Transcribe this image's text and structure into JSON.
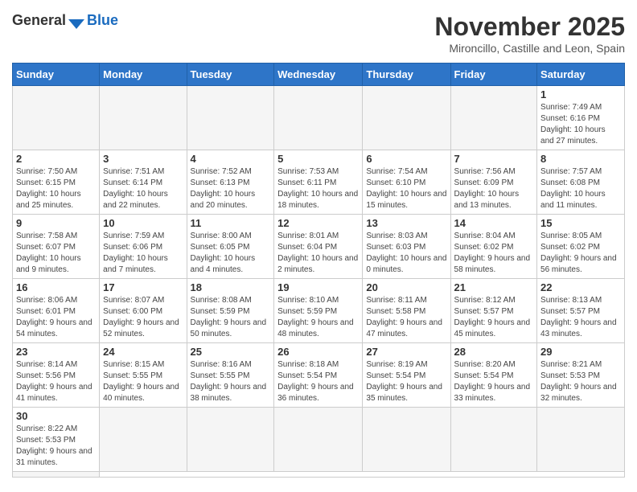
{
  "header": {
    "logo_general": "General",
    "logo_blue": "Blue",
    "month_title": "November 2025",
    "location": "Mironcillo, Castille and Leon, Spain"
  },
  "weekdays": [
    "Sunday",
    "Monday",
    "Tuesday",
    "Wednesday",
    "Thursday",
    "Friday",
    "Saturday"
  ],
  "days": [
    {
      "num": "",
      "info": ""
    },
    {
      "num": "",
      "info": ""
    },
    {
      "num": "",
      "info": ""
    },
    {
      "num": "",
      "info": ""
    },
    {
      "num": "",
      "info": ""
    },
    {
      "num": "",
      "info": ""
    },
    {
      "num": "1",
      "info": "Sunrise: 7:49 AM\nSunset: 6:16 PM\nDaylight: 10 hours and 27 minutes."
    },
    {
      "num": "2",
      "info": "Sunrise: 7:50 AM\nSunset: 6:15 PM\nDaylight: 10 hours and 25 minutes."
    },
    {
      "num": "3",
      "info": "Sunrise: 7:51 AM\nSunset: 6:14 PM\nDaylight: 10 hours and 22 minutes."
    },
    {
      "num": "4",
      "info": "Sunrise: 7:52 AM\nSunset: 6:13 PM\nDaylight: 10 hours and 20 minutes."
    },
    {
      "num": "5",
      "info": "Sunrise: 7:53 AM\nSunset: 6:11 PM\nDaylight: 10 hours and 18 minutes."
    },
    {
      "num": "6",
      "info": "Sunrise: 7:54 AM\nSunset: 6:10 PM\nDaylight: 10 hours and 15 minutes."
    },
    {
      "num": "7",
      "info": "Sunrise: 7:56 AM\nSunset: 6:09 PM\nDaylight: 10 hours and 13 minutes."
    },
    {
      "num": "8",
      "info": "Sunrise: 7:57 AM\nSunset: 6:08 PM\nDaylight: 10 hours and 11 minutes."
    },
    {
      "num": "9",
      "info": "Sunrise: 7:58 AM\nSunset: 6:07 PM\nDaylight: 10 hours and 9 minutes."
    },
    {
      "num": "10",
      "info": "Sunrise: 7:59 AM\nSunset: 6:06 PM\nDaylight: 10 hours and 7 minutes."
    },
    {
      "num": "11",
      "info": "Sunrise: 8:00 AM\nSunset: 6:05 PM\nDaylight: 10 hours and 4 minutes."
    },
    {
      "num": "12",
      "info": "Sunrise: 8:01 AM\nSunset: 6:04 PM\nDaylight: 10 hours and 2 minutes."
    },
    {
      "num": "13",
      "info": "Sunrise: 8:03 AM\nSunset: 6:03 PM\nDaylight: 10 hours and 0 minutes."
    },
    {
      "num": "14",
      "info": "Sunrise: 8:04 AM\nSunset: 6:02 PM\nDaylight: 9 hours and 58 minutes."
    },
    {
      "num": "15",
      "info": "Sunrise: 8:05 AM\nSunset: 6:02 PM\nDaylight: 9 hours and 56 minutes."
    },
    {
      "num": "16",
      "info": "Sunrise: 8:06 AM\nSunset: 6:01 PM\nDaylight: 9 hours and 54 minutes."
    },
    {
      "num": "17",
      "info": "Sunrise: 8:07 AM\nSunset: 6:00 PM\nDaylight: 9 hours and 52 minutes."
    },
    {
      "num": "18",
      "info": "Sunrise: 8:08 AM\nSunset: 5:59 PM\nDaylight: 9 hours and 50 minutes."
    },
    {
      "num": "19",
      "info": "Sunrise: 8:10 AM\nSunset: 5:59 PM\nDaylight: 9 hours and 48 minutes."
    },
    {
      "num": "20",
      "info": "Sunrise: 8:11 AM\nSunset: 5:58 PM\nDaylight: 9 hours and 47 minutes."
    },
    {
      "num": "21",
      "info": "Sunrise: 8:12 AM\nSunset: 5:57 PM\nDaylight: 9 hours and 45 minutes."
    },
    {
      "num": "22",
      "info": "Sunrise: 8:13 AM\nSunset: 5:57 PM\nDaylight: 9 hours and 43 minutes."
    },
    {
      "num": "23",
      "info": "Sunrise: 8:14 AM\nSunset: 5:56 PM\nDaylight: 9 hours and 41 minutes."
    },
    {
      "num": "24",
      "info": "Sunrise: 8:15 AM\nSunset: 5:55 PM\nDaylight: 9 hours and 40 minutes."
    },
    {
      "num": "25",
      "info": "Sunrise: 8:16 AM\nSunset: 5:55 PM\nDaylight: 9 hours and 38 minutes."
    },
    {
      "num": "26",
      "info": "Sunrise: 8:18 AM\nSunset: 5:54 PM\nDaylight: 9 hours and 36 minutes."
    },
    {
      "num": "27",
      "info": "Sunrise: 8:19 AM\nSunset: 5:54 PM\nDaylight: 9 hours and 35 minutes."
    },
    {
      "num": "28",
      "info": "Sunrise: 8:20 AM\nSunset: 5:54 PM\nDaylight: 9 hours and 33 minutes."
    },
    {
      "num": "29",
      "info": "Sunrise: 8:21 AM\nSunset: 5:53 PM\nDaylight: 9 hours and 32 minutes."
    },
    {
      "num": "30",
      "info": "Sunrise: 8:22 AM\nSunset: 5:53 PM\nDaylight: 9 hours and 31 minutes."
    },
    {
      "num": "",
      "info": ""
    },
    {
      "num": "",
      "info": ""
    },
    {
      "num": "",
      "info": ""
    },
    {
      "num": "",
      "info": ""
    },
    {
      "num": "",
      "info": ""
    },
    {
      "num": "",
      "info": ""
    },
    {
      "num": "",
      "info": ""
    }
  ]
}
